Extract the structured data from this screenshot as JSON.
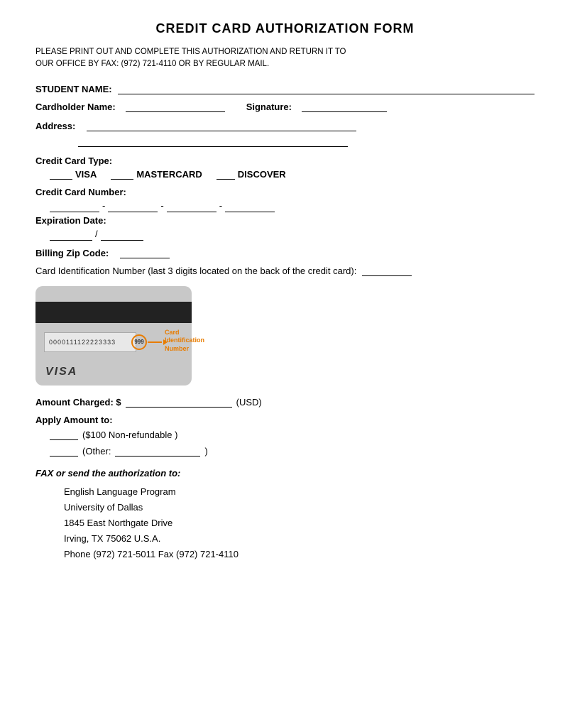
{
  "form": {
    "title": "CREDIT CARD AUTHORIZATION FORM",
    "instructions": "PLEASE PRINT OUT AND COMPLETE THIS AUTHORIZATION AND RETURN IT TO\nOUR OFFICE BY FAX: (972) 721-4110 OR BY REGULAR MAIL.",
    "fields": {
      "student_name_label": "STUDENT NAME:",
      "cardholder_name_label": "Cardholder Name:",
      "signature_label": "Signature:",
      "address_label": "Address:",
      "cc_type_label": "Credit Card Type:",
      "cc_type_options": [
        "VISA",
        "MASTERCARD",
        "DISCOVER"
      ],
      "cc_number_label": "Credit Card Number:",
      "expiration_label": "Expiration Date:",
      "billing_zip_label": "Billing Zip Code:",
      "card_id_label": "Card Identification Number (last 3 digits located on the back of the credit card):",
      "amount_charged_label": "Amount Charged:  $",
      "amount_currency": "(USD)",
      "apply_amount_label": "Apply Amount to:",
      "apply_option1": "($100 Non-refundable )",
      "apply_option2_prefix": "(Other:",
      "apply_option2_suffix": ")"
    },
    "card_illustration": {
      "number": "0000111122223333",
      "cvv": "999",
      "brand": "VISA",
      "id_label": "Card\nIdentification\nNumber"
    },
    "fax_section": {
      "label": "FAX or send the authorization to:",
      "address_lines": [
        "English Language Program",
        "University of Dallas",
        "1845 East Northgate Drive",
        "Irving, TX 75062     U.S.A.",
        "Phone (972) 721-5011   Fax (972) 721-4110"
      ]
    }
  }
}
